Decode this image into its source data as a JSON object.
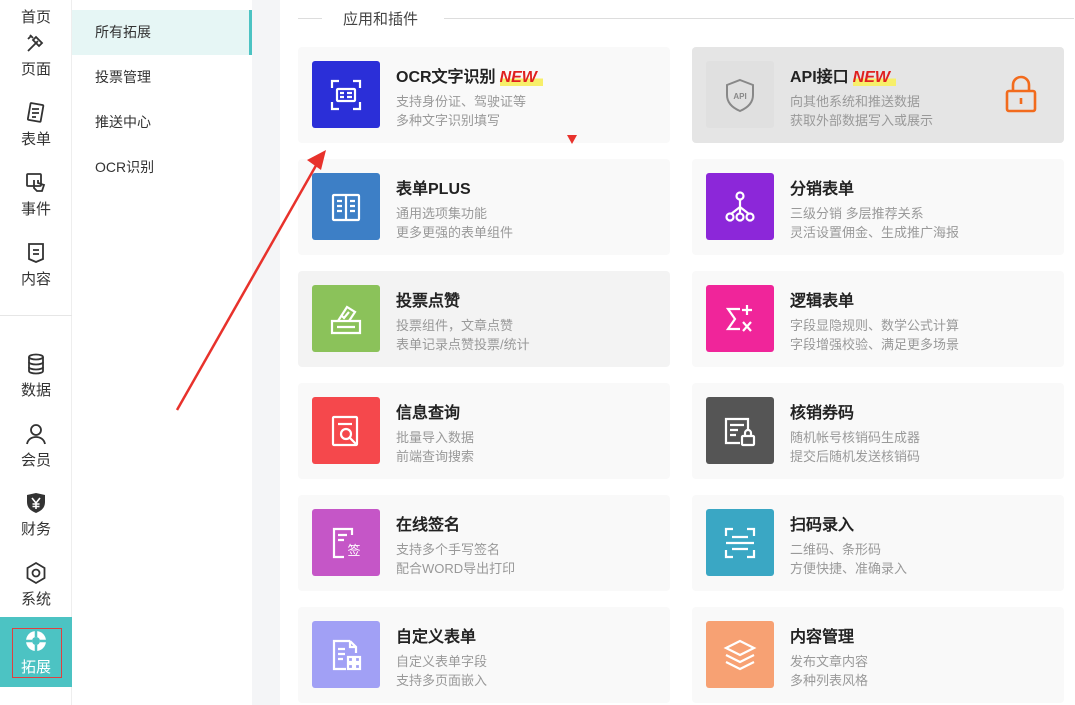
{
  "rail": {
    "items": [
      {
        "label": "首页",
        "icon": "home-icon"
      },
      {
        "label": "页面",
        "icon": "page-design-icon"
      },
      {
        "label": "表单",
        "icon": "form-icon"
      },
      {
        "label": "事件",
        "icon": "event-hand-icon"
      },
      {
        "label": "内容",
        "icon": "content-icon"
      },
      {
        "label": "数据",
        "icon": "database-icon"
      },
      {
        "label": "会员",
        "icon": "member-icon"
      },
      {
        "label": "财务",
        "icon": "finance-yen-icon"
      },
      {
        "label": "系统",
        "icon": "system-gear-icon"
      },
      {
        "label": "拓展",
        "icon": "extension-icon"
      }
    ],
    "active": "拓展"
  },
  "submenu": {
    "items": [
      "所有拓展",
      "投票管理",
      "推送中心",
      "OCR识别"
    ],
    "active": "所有拓展"
  },
  "section": {
    "title": "应用和插件"
  },
  "cards": [
    {
      "name": "OCR文字识别",
      "badge": "NEW",
      "d1": "支持身份证、驾驶证等",
      "d2": "多种文字识别填写",
      "color": "#2b2fd8",
      "icon": "ocr-scan-icon"
    },
    {
      "name": "API接口",
      "badge": "NEW",
      "d1": "向其他系统和推送数据",
      "d2": "获取外部数据写入或展示",
      "color": "#e0e0e0",
      "icon": "api-shield-icon",
      "locked": true
    },
    {
      "name": "表单PLUS",
      "d1": "通用选项集功能",
      "d2": "更多更强的表单组件",
      "color": "#3d7fc6",
      "icon": "form-plus-icon"
    },
    {
      "name": "分销表单",
      "d1": "三级分销 多层推荐关系",
      "d2": "灵活设置佣金、生成推广海报",
      "color": "#8c27d9",
      "icon": "distribution-tree-icon"
    },
    {
      "name": "投票点赞",
      "d1": "投票组件，文章点赞",
      "d2": "表单记录点赞投票/统计",
      "color": "#8bc25a",
      "icon": "vote-box-icon"
    },
    {
      "name": "逻辑表单",
      "d1": "字段显隐规则、数学公式计算",
      "d2": "字段增强校验、满足更多场景",
      "color": "#f0259a",
      "icon": "sigma-logic-icon"
    },
    {
      "name": "信息查询",
      "d1": "批量导入数据",
      "d2": "前端查询搜索",
      "color": "#f5484c",
      "icon": "search-doc-icon"
    },
    {
      "name": "核销券码",
      "d1": "随机帐号核销码生成器",
      "d2": "提交后随机发送核销码",
      "color": "#555555",
      "icon": "coupon-lock-icon"
    },
    {
      "name": "在线签名",
      "d1": "支持多个手写签名",
      "d2": "配合WORD导出打印",
      "color": "#c556c7",
      "icon": "signature-icon"
    },
    {
      "name": "扫码录入",
      "d1": "二维码、条形码",
      "d2": "方便快捷、准确录入",
      "color": "#3aa7c4",
      "icon": "scan-code-icon"
    },
    {
      "name": "自定义表单",
      "d1": "自定义表单字段",
      "d2": "支持多页面嵌入",
      "color": "#a1a0f5",
      "icon": "custom-form-icon"
    },
    {
      "name": "内容管理",
      "d1": "发布文章内容",
      "d2": "多种列表风格",
      "color": "#f7a173",
      "icon": "layers-icon"
    }
  ]
}
